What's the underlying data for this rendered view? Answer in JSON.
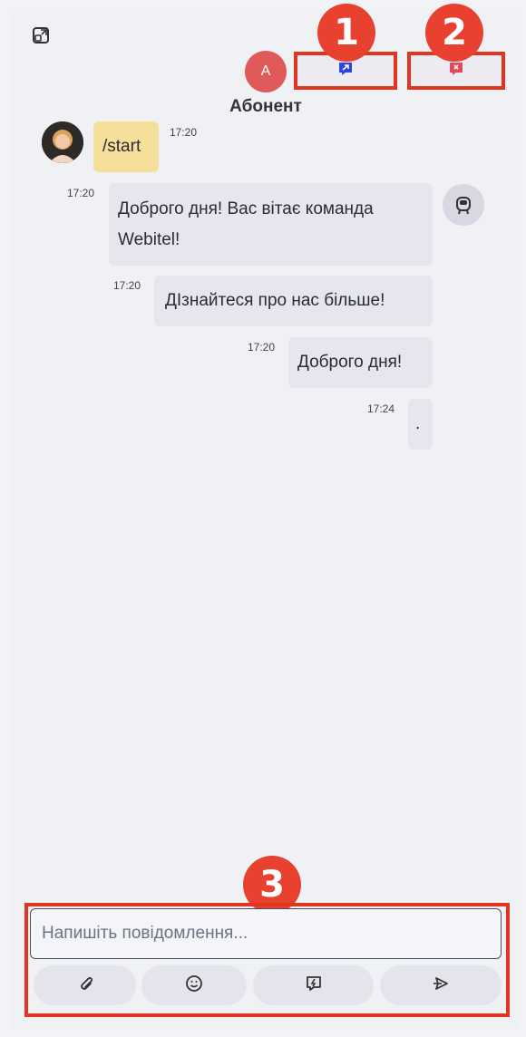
{
  "header": {
    "contact_initial": "A",
    "contact_name": "Абонент",
    "actions": [
      {
        "number": "1",
        "icon": "transfer-chat-icon",
        "color": "#2f45e0"
      },
      {
        "number": "2",
        "icon": "close-chat-icon",
        "color": "#e04a5a"
      }
    ]
  },
  "messages": [
    {
      "sender": "client",
      "text": "/start",
      "time": "17:20"
    },
    {
      "sender": "bot",
      "text": "Доброго дня! Вас вітає команда Webitel!",
      "time": "17:20"
    },
    {
      "sender": "bot",
      "text": "ДІзнайтеся про нас більше!",
      "time": "17:20"
    },
    {
      "sender": "bot",
      "text": "Доброго дня!",
      "time": "17:20"
    },
    {
      "sender": "bot",
      "text": ".",
      "time": "17:24"
    }
  ],
  "composer": {
    "number": "3",
    "placeholder": "Напишіть повідомлення...",
    "buttons": [
      "attach-icon",
      "emoji-icon",
      "quick-reply-icon",
      "send-icon"
    ]
  },
  "colors": {
    "highlight": "#e2351f",
    "client_bubble": "#f6df9a",
    "bot_bubble": "#e5e6ee",
    "avatar": "#e05a5a"
  }
}
